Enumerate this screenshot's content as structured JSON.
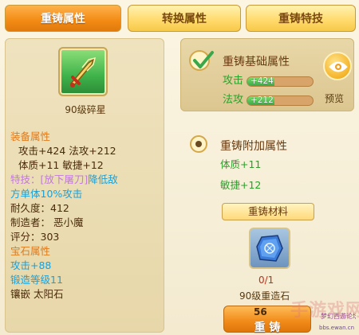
{
  "tabs": [
    {
      "label": "重铸属性",
      "active": true
    },
    {
      "label": "转换属性",
      "active": false
    },
    {
      "label": "重铸特技",
      "active": false
    }
  ],
  "weapon": {
    "name": "90级碎星",
    "icon": "sword-icon"
  },
  "equip_stats": {
    "heading": "装备属性",
    "line1": "攻击+424  法攻+212",
    "line2": "体质+11  敏捷+12",
    "special_prefix": "特技：",
    "special_name": "[放下屠刀]",
    "special_suffix": "降低敌",
    "special_line2": "方单体10%攻击",
    "durability": "耐久度：412",
    "maker": "制造者：   恶小魔",
    "score": "评分：303",
    "gem_heading": "宝石属性",
    "gem_line": "攻击+88",
    "forge_level": "锻造等级11",
    "inlay": "镶嵌   太阳石"
  },
  "base_recast": {
    "title": "重铸基础属性",
    "checked": true,
    "atk_label": "攻击",
    "atk_value": "+424",
    "mag_label": "法攻",
    "mag_value": "+212",
    "preview_label": "预览"
  },
  "extra_recast": {
    "title": "重铸附加属性",
    "line1": "体质+11",
    "line2": "敏捷+12"
  },
  "material": {
    "button_label": "重铸材料",
    "stone_count": "0/1",
    "stone_name": "90级重造石"
  },
  "recast": {
    "cost": "56",
    "button_label": "重  铸"
  },
  "watermark": {
    "text": "手游戏网",
    "site": "bbs.ewan.cn",
    "tag": "梦幻西游论坛"
  },
  "colors": {
    "accent_orange": "#f28a14",
    "stat_green": "#2aa02a",
    "skill_purple": "#c07ad8",
    "gem_blue": "#1aa0d8"
  }
}
